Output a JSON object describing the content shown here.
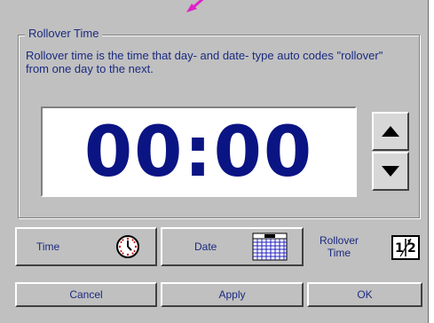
{
  "group": {
    "title": "Rollover Time",
    "description": "Rollover time is the time that day- and date- type auto codes \"rollover\" from one day to the next."
  },
  "time_display": {
    "value": "00:00"
  },
  "spinner": {
    "up_icon": "triangle-up-icon",
    "down_icon": "triangle-down-icon"
  },
  "tabs": [
    {
      "label": "Time",
      "icon": "clock-icon"
    },
    {
      "label": "Date",
      "icon": "calendar-icon"
    },
    {
      "label": "Rollover Time",
      "icon": "rollover-icon",
      "active": true
    }
  ],
  "buttons": {
    "cancel": "Cancel",
    "apply": "Apply",
    "ok": "OK"
  },
  "colors": {
    "background": "#c0c0c0",
    "text": "#1a2a80",
    "time_digits": "#0b1483",
    "pointer": "#e020c8"
  }
}
